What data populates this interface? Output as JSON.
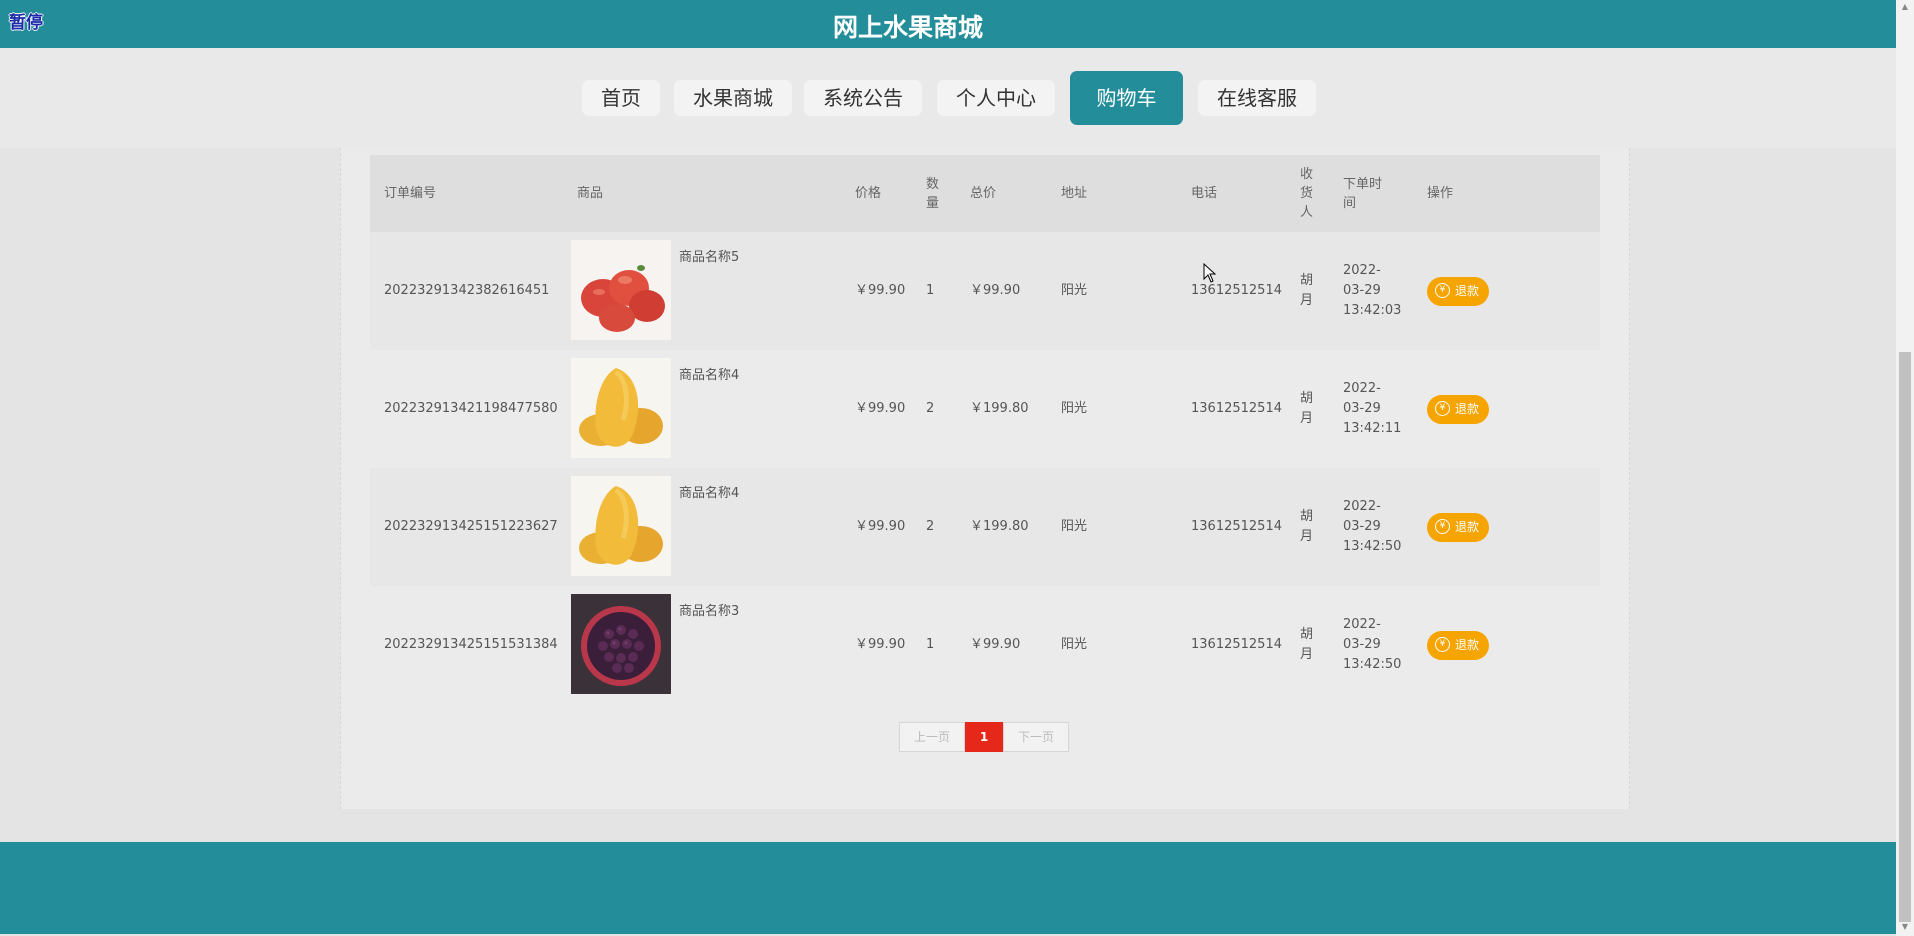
{
  "header": {
    "title": "网上水果商城",
    "pause_label": "暂停"
  },
  "nav": {
    "items": [
      {
        "label": "首页"
      },
      {
        "label": "水果商城"
      },
      {
        "label": "系统公告"
      },
      {
        "label": "个人中心"
      },
      {
        "label": "购物车"
      },
      {
        "label": "在线客服"
      }
    ],
    "active_index": 4
  },
  "table": {
    "headers": {
      "order_no": "订单编号",
      "goods": "商品",
      "price": "价格",
      "qty": "数量",
      "total": "总价",
      "address": "地址",
      "phone": "电话",
      "receiver": "收货人",
      "order_time": "下单时间",
      "action": "操作"
    },
    "rows": [
      {
        "order_no": "20223291342382616451",
        "goods_name": "商品名称5",
        "image": "red-wax-apple",
        "price": "￥99.90",
        "qty": "1",
        "total": "￥99.90",
        "address": "阳光",
        "phone": "13612512514",
        "receiver": "胡月",
        "time_date": "2022-03-29",
        "time_clock": "13:42:03",
        "action_label": "退款"
      },
      {
        "order_no": "20223291342119847758​0",
        "goods_name": "商品名称4",
        "image": "mango",
        "price": "￥99.90",
        "qty": "2",
        "total": "￥199.80",
        "address": "阳光",
        "phone": "13612512514",
        "receiver": "胡月",
        "time_date": "2022-03-29",
        "time_clock": "13:42:11",
        "action_label": "退款"
      },
      {
        "order_no": "20223291342515122362​7",
        "goods_name": "商品名称4",
        "image": "mango",
        "price": "￥99.90",
        "qty": "2",
        "total": "￥199.80",
        "address": "阳光",
        "phone": "13612512514",
        "receiver": "胡月",
        "time_date": "2022-03-29",
        "time_clock": "13:42:50",
        "action_label": "退款"
      },
      {
        "order_no": "20223291342515153138​4",
        "goods_name": "商品名称3",
        "image": "blueberry-bouquet",
        "price": "￥99.90",
        "qty": "1",
        "total": "￥99.90",
        "address": "阳光",
        "phone": "13612512514",
        "receiver": "胡月",
        "time_date": "2022-03-29",
        "time_clock": "13:42:50",
        "action_label": "退款"
      }
    ]
  },
  "pagination": {
    "prev_label": "上一页",
    "current": "1",
    "next_label": "下一页"
  },
  "colors": {
    "brand": "#238e9a",
    "refund": "#f6a400",
    "page_active": "#e5281a"
  }
}
